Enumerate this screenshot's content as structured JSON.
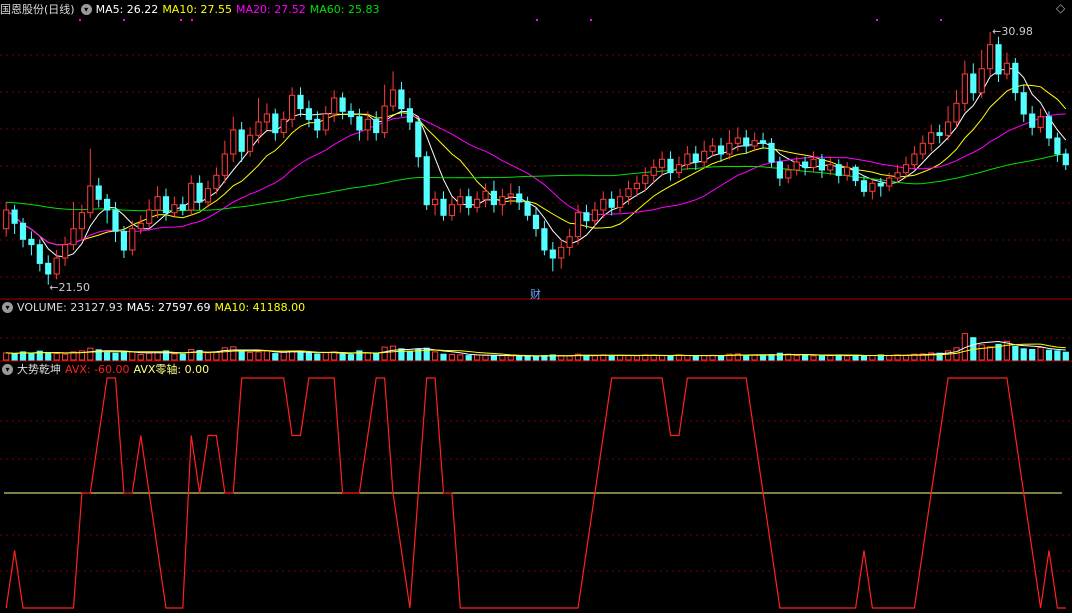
{
  "colors": {
    "up": "#ff3b3b",
    "down": "#54ffff",
    "ma5": "#ffffff",
    "ma10": "#ffff00",
    "ma20": "#ff00ff",
    "ma60": "#00e000",
    "avx": "#ff2020",
    "zero": "#ffff80",
    "grid": "#7a0000"
  },
  "price_panel": {
    "stock_name": "国恩股份",
    "period": "(日线)",
    "ma5_label": "MA5: 26.22",
    "ma10_label": "MA10: 27.55",
    "ma20_label": "MA20: 27.52",
    "ma60_label": "MA60: 25.83",
    "high_label": "30.98",
    "low_label": "21.50",
    "event_marker": "财",
    "corner_icon": "diamond-icon"
  },
  "volume_panel": {
    "volume_label": "VOLUME: 23127.93",
    "ma5_label": "MA5: 27597.69",
    "ma10_label": "MA10: 41188.00"
  },
  "indicator_panel": {
    "name": "大势乾坤",
    "avx_label": "AVX: -60.00",
    "zero_label": "AVX零轴: 0.00"
  },
  "chart_data": [
    {
      "type": "candlestick",
      "name": "price",
      "ylim": [
        21.0,
        31.5
      ],
      "high": 30.98,
      "low": 21.5,
      "bars": [
        [
          23.6,
          24.3,
          24.6,
          23.3
        ],
        [
          24.3,
          23.8,
          24.5,
          23.4
        ],
        [
          23.8,
          23.2,
          24.0,
          22.9
        ],
        [
          23.2,
          23.0,
          23.5,
          22.6
        ],
        [
          23.0,
          22.3,
          23.2,
          22.0
        ],
        [
          22.3,
          21.9,
          22.6,
          21.5
        ],
        [
          21.9,
          22.5,
          22.8,
          21.7
        ],
        [
          22.5,
          23.0,
          23.3,
          22.2
        ],
        [
          23.0,
          23.6,
          24.6,
          22.8
        ],
        [
          23.6,
          24.2,
          24.5,
          23.2
        ],
        [
          24.2,
          25.2,
          26.6,
          24.0
        ],
        [
          25.2,
          24.7,
          25.5,
          24.4
        ],
        [
          24.7,
          24.3,
          24.9,
          23.8
        ],
        [
          24.3,
          23.5,
          24.6,
          23.1
        ],
        [
          23.5,
          22.8,
          23.7,
          22.5
        ],
        [
          22.8,
          23.6,
          23.9,
          22.6
        ],
        [
          23.6,
          23.8,
          24.1,
          23.4
        ],
        [
          23.8,
          24.3,
          24.7,
          23.6
        ],
        [
          24.3,
          24.8,
          25.2,
          24.0
        ],
        [
          24.8,
          24.2,
          25.1,
          23.9
        ],
        [
          24.2,
          24.5,
          24.8,
          24.0
        ],
        [
          24.5,
          24.3,
          24.8,
          24.1
        ],
        [
          24.3,
          25.3,
          25.6,
          24.1
        ],
        [
          25.3,
          24.6,
          25.6,
          24.3
        ],
        [
          24.6,
          25.1,
          25.4,
          24.4
        ],
        [
          25.1,
          25.6,
          25.9,
          24.9
        ],
        [
          25.6,
          26.4,
          26.9,
          25.3
        ],
        [
          26.4,
          27.3,
          27.8,
          26.1
        ],
        [
          27.3,
          26.5,
          27.6,
          26.1
        ],
        [
          26.5,
          27.1,
          27.4,
          26.3
        ],
        [
          27.1,
          27.6,
          28.5,
          26.8
        ],
        [
          27.6,
          27.9,
          28.3,
          27.3
        ],
        [
          27.9,
          27.2,
          28.1,
          26.9
        ],
        [
          27.2,
          27.7,
          28.0,
          27.0
        ],
        [
          27.7,
          28.6,
          28.9,
          27.4
        ],
        [
          28.6,
          28.1,
          28.9,
          27.8
        ],
        [
          28.1,
          27.7,
          28.4,
          27.4
        ],
        [
          27.7,
          27.3,
          28.0,
          27.0
        ],
        [
          27.3,
          27.9,
          28.2,
          27.1
        ],
        [
          27.9,
          28.5,
          28.8,
          27.6
        ],
        [
          28.5,
          28.0,
          28.7,
          27.7
        ],
        [
          28.0,
          27.8,
          28.3,
          27.5
        ],
        [
          27.8,
          27.3,
          28.1,
          26.9
        ],
        [
          27.3,
          27.7,
          28.0,
          26.9
        ],
        [
          27.7,
          27.2,
          28.0,
          26.9
        ],
        [
          27.2,
          28.2,
          29.0,
          27.0
        ],
        [
          28.2,
          28.8,
          29.5,
          28.0
        ],
        [
          28.8,
          28.1,
          29.1,
          27.8
        ],
        [
          28.1,
          27.6,
          28.5,
          27.3
        ],
        [
          27.6,
          26.3,
          27.8,
          25.9
        ],
        [
          26.3,
          24.5,
          26.5,
          24.3
        ],
        [
          24.5,
          24.7,
          25.0,
          24.1
        ],
        [
          24.7,
          24.1,
          25.0,
          23.9
        ],
        [
          24.1,
          24.5,
          24.8,
          23.9
        ],
        [
          24.5,
          24.8,
          25.1,
          24.2
        ],
        [
          24.8,
          24.4,
          25.1,
          24.1
        ],
        [
          24.4,
          24.7,
          25.0,
          24.2
        ],
        [
          24.7,
          25.0,
          25.3,
          24.4
        ],
        [
          25.0,
          24.5,
          25.4,
          24.2
        ],
        [
          24.5,
          24.8,
          25.1,
          24.1
        ],
        [
          24.8,
          24.9,
          25.3,
          24.5
        ],
        [
          24.9,
          24.6,
          25.2,
          24.3
        ],
        [
          24.6,
          24.1,
          24.8,
          23.9
        ],
        [
          24.1,
          23.6,
          24.4,
          23.3
        ],
        [
          23.6,
          22.8,
          23.9,
          22.6
        ],
        [
          22.8,
          22.5,
          23.1,
          22.0
        ],
        [
          22.5,
          22.9,
          23.2,
          22.1
        ],
        [
          22.9,
          23.3,
          23.6,
          22.6
        ],
        [
          23.3,
          24.2,
          24.5,
          23.0
        ],
        [
          24.2,
          23.9,
          24.5,
          23.6
        ],
        [
          23.9,
          24.3,
          24.6,
          23.7
        ],
        [
          24.3,
          24.7,
          25.0,
          24.0
        ],
        [
          24.7,
          24.4,
          25.0,
          24.1
        ],
        [
          24.4,
          24.8,
          25.1,
          24.2
        ],
        [
          24.8,
          25.1,
          25.4,
          24.5
        ],
        [
          25.1,
          25.3,
          25.6,
          24.8
        ],
        [
          25.3,
          25.6,
          25.9,
          25.0
        ],
        [
          25.6,
          25.9,
          26.2,
          25.3
        ],
        [
          25.9,
          26.2,
          26.5,
          25.6
        ],
        [
          26.2,
          25.7,
          26.5,
          25.4
        ],
        [
          25.7,
          26.0,
          26.3,
          25.5
        ],
        [
          26.0,
          26.4,
          26.7,
          25.8
        ],
        [
          26.4,
          26.1,
          26.7,
          25.8
        ],
        [
          26.1,
          26.5,
          26.9,
          25.9
        ],
        [
          26.5,
          26.7,
          27.0,
          26.3
        ],
        [
          26.7,
          26.4,
          27.0,
          26.1
        ],
        [
          26.4,
          26.8,
          27.3,
          26.2
        ],
        [
          26.8,
          27.0,
          27.4,
          26.5
        ],
        [
          27.0,
          26.7,
          27.3,
          26.4
        ],
        [
          26.7,
          26.9,
          27.2,
          26.5
        ],
        [
          26.9,
          26.8,
          27.2,
          26.6
        ],
        [
          26.8,
          26.1,
          27.0,
          25.9
        ],
        [
          26.1,
          25.5,
          26.3,
          25.2
        ],
        [
          25.5,
          25.8,
          26.0,
          25.3
        ],
        [
          25.8,
          26.1,
          26.3,
          25.6
        ],
        [
          26.1,
          25.9,
          26.3,
          25.6
        ],
        [
          25.9,
          26.2,
          26.5,
          25.7
        ],
        [
          26.2,
          25.8,
          26.4,
          25.5
        ],
        [
          25.8,
          26.0,
          26.3,
          25.6
        ],
        [
          26.0,
          25.6,
          26.2,
          25.3
        ],
        [
          25.6,
          25.9,
          26.1,
          25.4
        ],
        [
          25.9,
          25.4,
          26.0,
          25.2
        ],
        [
          25.4,
          25.0,
          25.6,
          24.8
        ],
        [
          25.0,
          25.3,
          25.5,
          24.7
        ],
        [
          25.3,
          25.2,
          25.5,
          24.8
        ],
        [
          25.2,
          25.5,
          25.7,
          25.0
        ],
        [
          25.5,
          25.7,
          26.0,
          25.3
        ],
        [
          25.7,
          26.0,
          26.3,
          25.5
        ],
        [
          26.0,
          26.4,
          26.7,
          25.8
        ],
        [
          26.4,
          26.8,
          27.1,
          26.2
        ],
        [
          26.8,
          27.2,
          27.5,
          26.5
        ],
        [
          27.2,
          27.1,
          27.5,
          26.8
        ],
        [
          27.1,
          27.6,
          28.2,
          26.9
        ],
        [
          27.6,
          28.3,
          28.8,
          27.4
        ],
        [
          28.3,
          29.4,
          29.9,
          28.0
        ],
        [
          29.4,
          28.7,
          29.8,
          28.4
        ],
        [
          28.7,
          29.6,
          30.3,
          28.5
        ],
        [
          29.6,
          30.5,
          30.98,
          29.3
        ],
        [
          30.5,
          29.4,
          30.8,
          29.1
        ],
        [
          29.4,
          29.8,
          30.2,
          29.2
        ],
        [
          29.8,
          28.7,
          30.0,
          28.4
        ],
        [
          28.7,
          27.9,
          29.0,
          27.6
        ],
        [
          27.9,
          27.4,
          28.2,
          27.1
        ],
        [
          27.4,
          27.8,
          28.1,
          27.2
        ],
        [
          27.8,
          27.0,
          28.0,
          26.7
        ],
        [
          27.0,
          26.4,
          27.2,
          26.1
        ],
        [
          26.4,
          26.0,
          26.6,
          25.8
        ]
      ]
    },
    {
      "type": "bar",
      "name": "volume",
      "ylim": [
        0,
        130000
      ],
      "values": [
        21000,
        18000,
        24000,
        20000,
        26000,
        22000,
        19000,
        17000,
        24000,
        27000,
        35000,
        30000,
        22000,
        20000,
        26000,
        24000,
        16000,
        20000,
        22000,
        27000,
        18000,
        17000,
        31000,
        28000,
        21000,
        24000,
        36000,
        39000,
        27000,
        22000,
        24000,
        27000,
        19000,
        23000,
        26000,
        25000,
        20000,
        18000,
        22000,
        24000,
        17000,
        16000,
        27000,
        21000,
        18000,
        38000,
        41000,
        33000,
        26000,
        31000,
        35000,
        24000,
        17000,
        16000,
        15000,
        13000,
        15000,
        14000,
        12000,
        13000,
        12000,
        11000,
        12000,
        11000,
        13000,
        15000,
        13000,
        12000,
        17000,
        14000,
        13000,
        15000,
        12000,
        14000,
        13000,
        12000,
        15000,
        14000,
        13000,
        12000,
        15000,
        13000,
        12000,
        13000,
        14000,
        12000,
        17000,
        18000,
        13000,
        15000,
        14000,
        16000,
        20000,
        17000,
        13000,
        15000,
        12000,
        14000,
        13000,
        15000,
        12000,
        14000,
        12000,
        13000,
        15000,
        13000,
        15000,
        14000,
        17000,
        18000,
        21000,
        20000,
        27000,
        36000,
        78000,
        66000,
        45000,
        39000,
        46000,
        55000,
        40000,
        33000,
        31000,
        37000,
        29000,
        27000,
        23127.93
      ]
    },
    {
      "type": "line",
      "name": "AVX",
      "ylim": [
        -60,
        60
      ],
      "values": [
        -60,
        -30,
        -60,
        -60,
        -60,
        -60,
        -60,
        -60,
        -60,
        0,
        0,
        30,
        60,
        60,
        0,
        0,
        30,
        0,
        -30,
        -60,
        -60,
        -60,
        30,
        0,
        30,
        30,
        0,
        0,
        60,
        60,
        60,
        60,
        60,
        60,
        30,
        30,
        60,
        60,
        60,
        60,
        0,
        0,
        0,
        30,
        60,
        60,
        0,
        -30,
        -60,
        0,
        60,
        60,
        0,
        0,
        -60,
        -60,
        -60,
        -60,
        -60,
        -60,
        -60,
        -60,
        -60,
        -60,
        -60,
        -60,
        -60,
        -60,
        -60,
        -30,
        0,
        30,
        60,
        60,
        60,
        60,
        60,
        60,
        60,
        30,
        30,
        60,
        60,
        60,
        60,
        60,
        60,
        60,
        60,
        30,
        0,
        -30,
        -60,
        -60,
        -60,
        -60,
        -60,
        -60,
        -60,
        -60,
        -60,
        -60,
        -30,
        -60,
        -60,
        -60,
        -60,
        -60,
        -60,
        -30,
        0,
        30,
        60,
        60,
        60,
        60,
        60,
        60,
        60,
        60,
        30,
        0,
        -30,
        -60,
        -30,
        -60,
        -60
      ]
    }
  ]
}
